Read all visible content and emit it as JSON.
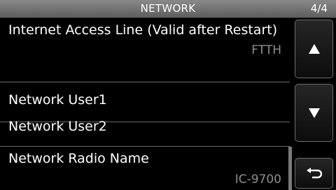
{
  "header": {
    "title": "NETWORK",
    "page": "4/4"
  },
  "menu": {
    "items": [
      {
        "label": "Internet Access Line (Valid after Restart)",
        "value": "FTTH"
      },
      {
        "label": "Network User1",
        "value": ""
      },
      {
        "label": "Network User2",
        "value": ""
      },
      {
        "label": "Network Radio Name",
        "value": "IC-9700"
      }
    ]
  },
  "buttons": {
    "up_icon": "arrow-up-icon",
    "down_icon": "arrow-down-icon",
    "back_icon": "return-icon"
  }
}
